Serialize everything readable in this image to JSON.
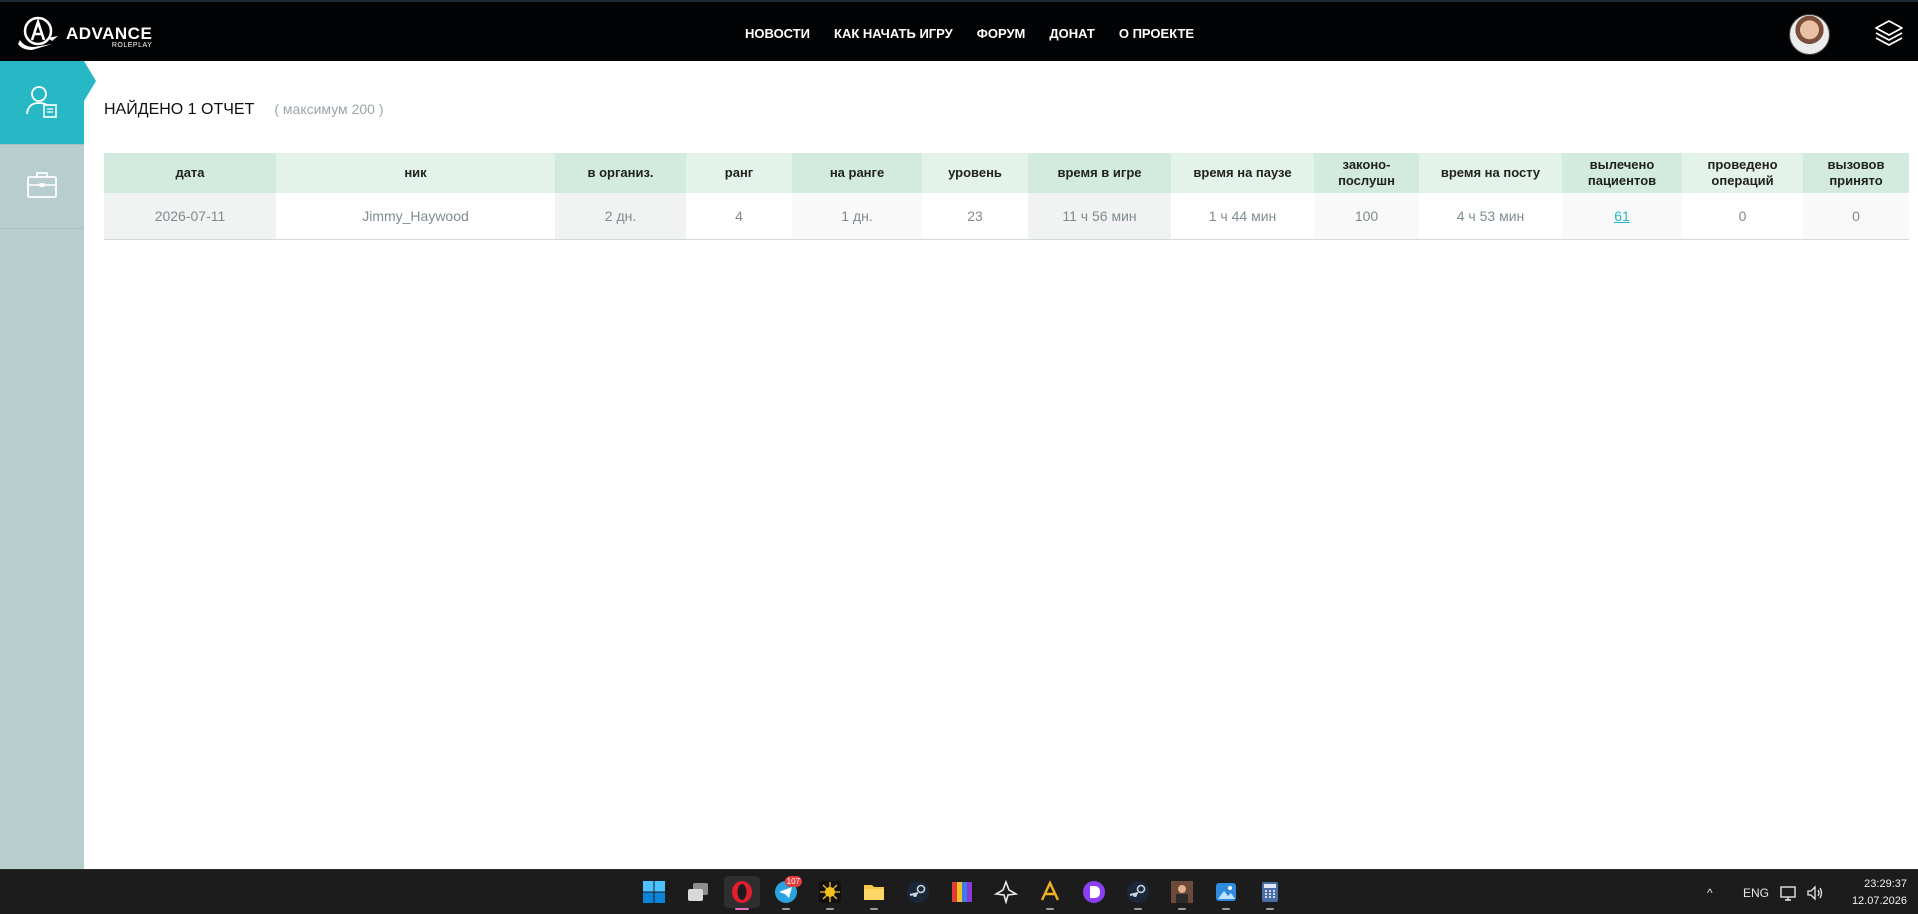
{
  "header": {
    "logo_text": "ADVANCE",
    "logo_subtext": "ROLEPLAY",
    "nav": [
      {
        "label": "НОВОСТИ"
      },
      {
        "label": "КАК НАЧАТЬ ИГРУ"
      },
      {
        "label": "ФОРУМ"
      },
      {
        "label": "ДОНАТ"
      },
      {
        "label": "О ПРОЕКТЕ"
      }
    ]
  },
  "sidebar": {
    "items": [
      {
        "icon": "user-report-icon",
        "active": true
      },
      {
        "icon": "briefcase-icon",
        "active": false
      }
    ]
  },
  "report": {
    "title": "НАЙДЕНО 1 ОТЧЕТ",
    "subtitle": "( максимум 200 )",
    "columns": [
      "дата",
      "ник",
      "в организ.",
      "ранг",
      "на ранге",
      "уровень",
      "время в игре",
      "время на паузе",
      "законо-послушн",
      "время на посту",
      "вылечено пациентов",
      "проведено операций",
      "вызовов принято"
    ],
    "rows": [
      [
        "2026-07-11",
        "Jimmy_Haywood",
        "2 дн.",
        "4",
        "1 дн.",
        "23",
        "11 ч 56 мин",
        "1 ч 44 мин",
        "100",
        "4 ч 53 мин",
        "61",
        "0",
        "0"
      ]
    ]
  },
  "taskbar": {
    "apps": [
      {
        "icon": "windows-start-icon"
      },
      {
        "icon": "task-view-icon"
      },
      {
        "icon": "opera-browser-icon",
        "active": true
      },
      {
        "icon": "telegram-icon",
        "badge": "107"
      },
      {
        "icon": "sun-app-icon"
      },
      {
        "icon": "file-explorer-icon"
      },
      {
        "icon": "steam-icon"
      },
      {
        "icon": "color-bars-icon"
      },
      {
        "icon": "triad-logo-icon"
      },
      {
        "icon": "advance-launcher-icon"
      },
      {
        "icon": "purple-d-icon"
      },
      {
        "icon": "steam-icon"
      },
      {
        "icon": "game-character-icon"
      },
      {
        "icon": "photos-icon"
      },
      {
        "icon": "calculator-icon"
      }
    ],
    "tray": {
      "caret": "^",
      "language": "ENG",
      "time": "23:29:37",
      "date": "12.07.2026"
    }
  },
  "colors": {
    "accent": "#27b8c6",
    "sidebar": "#b8cece",
    "header_bg": "#020304",
    "table_header_a": "#d2ebde",
    "table_header_b": "#e3f3ea",
    "link": "#29b2c4"
  }
}
